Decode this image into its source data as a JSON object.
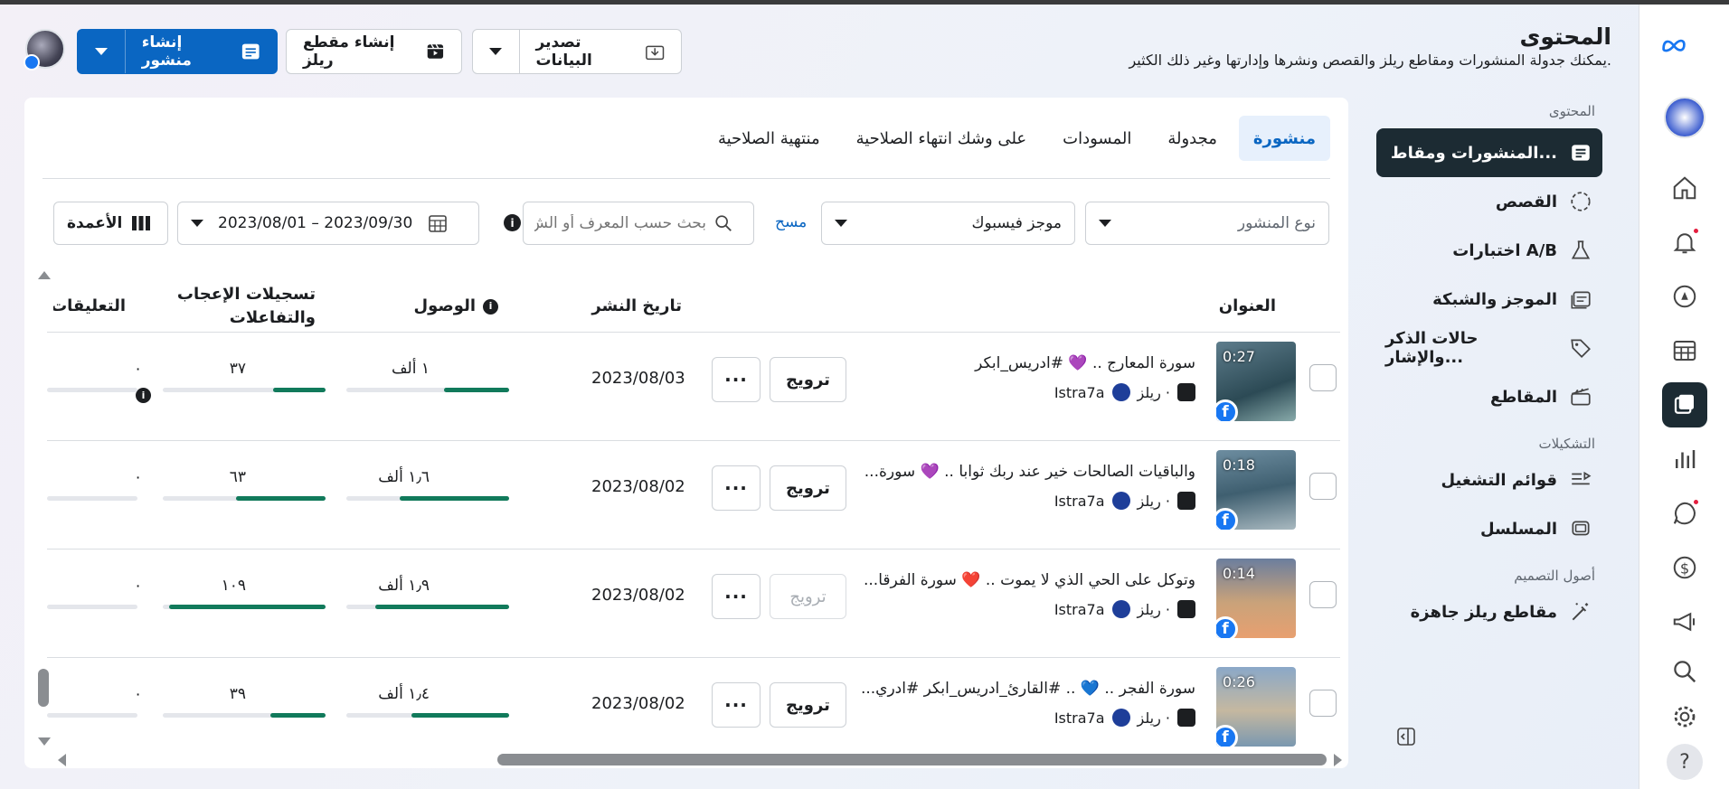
{
  "header": {
    "title": "المحتوى",
    "subtitle": "يمكنك جدولة المنشورات ومقاطع ريلز والقصص ونشرها وإدارتها وغير ذلك الكثير."
  },
  "toolbar": {
    "export_label": "تصدير البيانات",
    "reel_label": "إنشاء مقطع ريلز",
    "post_label": "إنشاء منشور"
  },
  "sidebar": {
    "section_content": "المحتوى",
    "items": [
      {
        "label": "المنشورات ومقاط...",
        "icon": "posts-icon"
      },
      {
        "label": "القصص",
        "icon": "stories-icon"
      },
      {
        "label": "اختبارات A/B",
        "icon": "flask-icon"
      },
      {
        "label": "الموجز والشبكة",
        "icon": "feed-icon"
      },
      {
        "label": "حالات الذكر والإشار...",
        "icon": "tag-icon"
      },
      {
        "label": "المقاطع",
        "icon": "clapper-icon"
      }
    ],
    "section_collections": "التشكيلات",
    "collections": [
      {
        "label": "قوائم التشغيل",
        "icon": "playlist-icon"
      },
      {
        "label": "المسلسل",
        "icon": "series-icon"
      }
    ],
    "section_assets": "أصول التصميم",
    "assets": [
      {
        "label": "مقاطع ريلز جاهزة",
        "icon": "magic-wand-icon"
      }
    ]
  },
  "tabs": [
    "منشورة",
    "مجدولة",
    "المسودات",
    "على وشك انتهاء الصلاحية",
    "منتهية الصلاحية"
  ],
  "filters": {
    "post_type_placeholder": "نوع المنشور",
    "feed": "موجز فيسبوك",
    "clear": "مسح",
    "search_placeholder": "بحث حسب المعرف أو الش",
    "date_range": "2023/08/01 – 2023/09/30",
    "columns": "الأعمدة"
  },
  "table": {
    "headers": {
      "title": "العنوان",
      "date": "تاريخ النشر",
      "reach": "الوصول",
      "likes_l1": "تسجيلات الإعجاب",
      "likes_l2": "والتفاعلات",
      "comments": "التعليقات"
    },
    "rows": [
      {
        "duration": "0:27",
        "title": "سورة المعارج .. 💜 #ادريس_ابكر",
        "type": "ريلز ·",
        "account": "Istra7a",
        "promote": "ترويج",
        "date": "2023/08/03",
        "reach": "١ ألف",
        "reach_pct": 0.4,
        "likes": "٣٧",
        "likes_pct": 0.32,
        "comments": "٠"
      },
      {
        "duration": "0:18",
        "title": "والباقيات الصالحات خير عند ربك ثوابا .. 💜 سورة...",
        "type": "ريلز ·",
        "account": "Istra7a",
        "promote": "ترويج",
        "date": "2023/08/02",
        "reach": "١٫٦ ألف",
        "reach_pct": 0.68,
        "likes": "٦٣",
        "likes_pct": 0.55,
        "comments": "٠"
      },
      {
        "duration": "0:14",
        "title": "وتوكل على الحي الذي لا يموت .. ❤️ سورة الفرقا...",
        "type": "ريلز ·",
        "account": "Istra7a",
        "promote": "ترويج",
        "date": "2023/08/02",
        "reach": "١٫٩ ألف",
        "reach_pct": 0.82,
        "likes": "١٠٩",
        "likes_pct": 0.96,
        "comments": "٠"
      },
      {
        "duration": "0:26",
        "title": "سورة الفجر .. 💙 .. #القارئ_ادريس_ابكر #ادري...",
        "type": "ريلز ·",
        "account": "Istra7a",
        "promote": "ترويج",
        "date": "2023/08/02",
        "reach": "١٫٤ ألف",
        "reach_pct": 0.6,
        "likes": "٣٩",
        "likes_pct": 0.34,
        "comments": "٠"
      }
    ]
  },
  "colors": {
    "accent": "#0a66c2",
    "dark": "#1c2b33",
    "bar_fill": "#117a5b"
  }
}
